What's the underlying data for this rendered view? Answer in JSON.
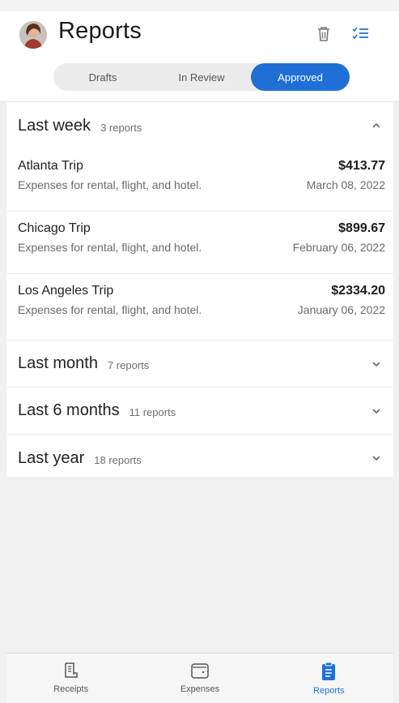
{
  "header": {
    "title": "Reports",
    "avatar_icon": "user-avatar",
    "trash_icon": "trash-icon",
    "filter_icon": "checklist-icon"
  },
  "segments": {
    "items": [
      "Drafts",
      "In Review",
      "Approved"
    ],
    "selected": "Approved"
  },
  "groups": [
    {
      "title": "Last week",
      "count": "3 reports",
      "expanded": true,
      "reports": [
        {
          "name": "Atlanta Trip",
          "description": "Expenses for rental, flight, and hotel.",
          "amount": "$413.77",
          "date": "March 08, 2022"
        },
        {
          "name": "Chicago Trip",
          "description": "Expenses for rental, flight, and hotel.",
          "amount": "$899.67",
          "date": "February 06, 2022"
        },
        {
          "name": "Los Angeles Trip",
          "description": "Expenses for rental, flight, and hotel.",
          "amount": "$2334.20",
          "date": "January 06, 2022"
        }
      ]
    },
    {
      "title": "Last month",
      "count": "7 reports",
      "expanded": false
    },
    {
      "title": "Last 6 months",
      "count": "11 reports",
      "expanded": false
    },
    {
      "title": "Last year",
      "count": "18 reports",
      "expanded": false
    }
  ],
  "nav": {
    "items": [
      {
        "label": "Receipts",
        "icon": "receipt-icon"
      },
      {
        "label": "Expenses",
        "icon": "wallet-icon"
      },
      {
        "label": "Reports",
        "icon": "clipboard-icon"
      }
    ],
    "selected": "Reports"
  },
  "colors": {
    "accent": "#1f6fd6",
    "background": "#f1f1f1",
    "card": "#ffffff"
  }
}
